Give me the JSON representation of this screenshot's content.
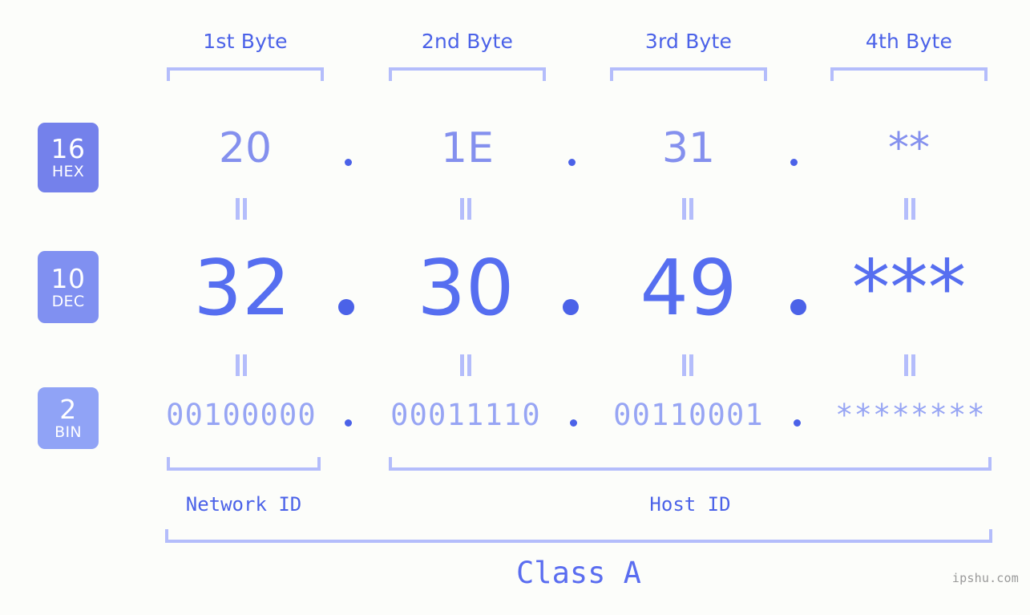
{
  "background_color": "#fcfdfa",
  "accent_color": "#4b62e8",
  "bracket_color": "#b4bdfb",
  "header": {
    "byte_labels": [
      "1st Byte",
      "2nd Byte",
      "3rd Byte",
      "4th Byte"
    ]
  },
  "rows": [
    {
      "id": "hex",
      "badge_number": "16",
      "badge_name": "HEX",
      "badge_color": "#7481eb",
      "values": [
        "20",
        "1E",
        "31",
        "**"
      ],
      "separator": "."
    },
    {
      "id": "dec",
      "badge_number": "10",
      "badge_name": "DEC",
      "badge_color": "#8090f1",
      "values": [
        "32",
        "30",
        "49",
        "***"
      ],
      "separator": "."
    },
    {
      "id": "bin",
      "badge_number": "2",
      "badge_name": "BIN",
      "badge_color": "#90a3f6",
      "values": [
        "00100000",
        "00011110",
        "00110001",
        "********"
      ],
      "separator": "."
    }
  ],
  "equivalence_marker": "||",
  "footer": {
    "network_id_label": "Network ID",
    "host_id_label": "Host ID",
    "class_label": "Class A"
  },
  "watermark": "ipshu.com"
}
